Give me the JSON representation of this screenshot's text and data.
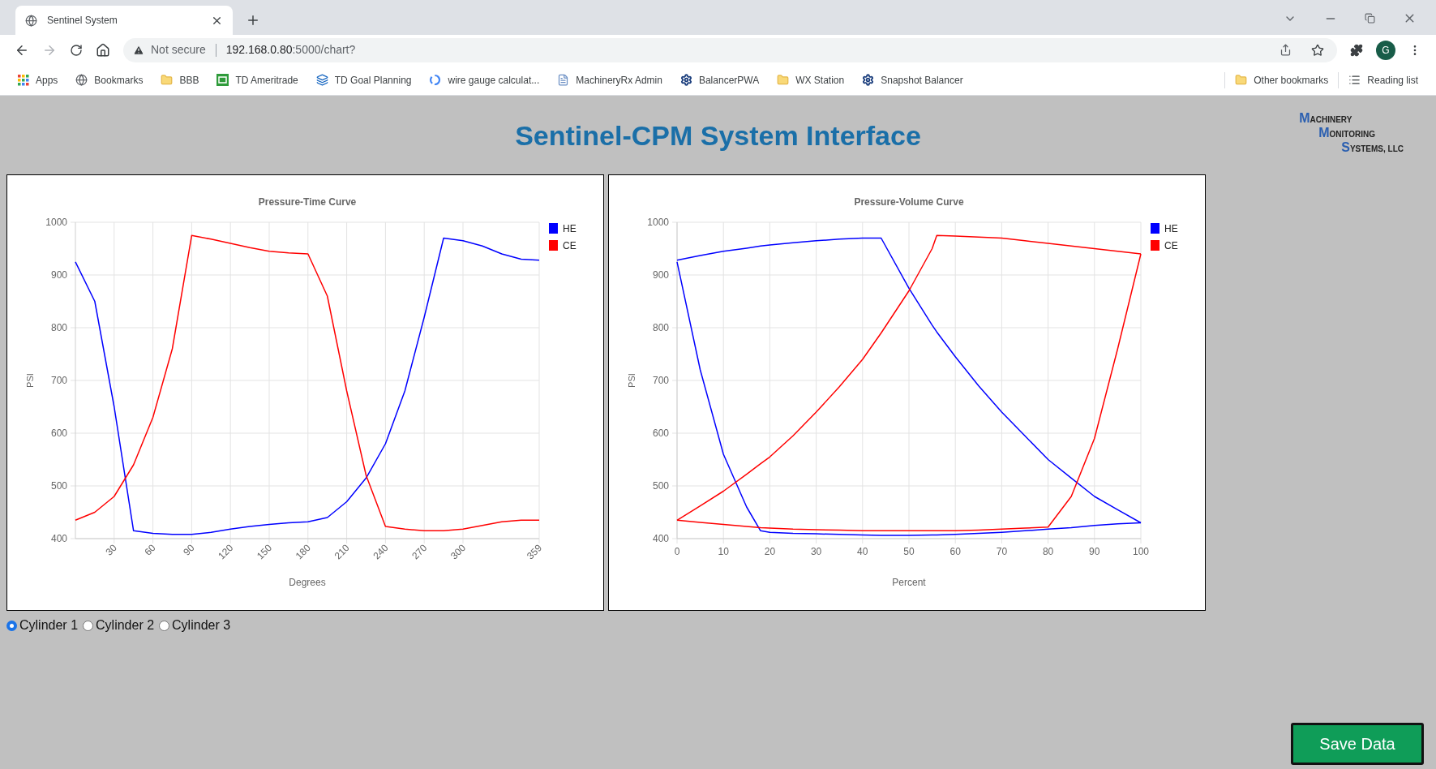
{
  "browser": {
    "tab": {
      "title": "Sentinel System"
    },
    "address": {
      "security": "Not secure",
      "host": "192.168.0.80",
      "path": ":5000/chart?"
    },
    "avatar": "G",
    "bookmarks": [
      {
        "kind": "apps",
        "label": "Apps"
      },
      {
        "kind": "globe",
        "label": "Bookmarks"
      },
      {
        "kind": "folder",
        "label": "BBB"
      },
      {
        "kind": "td",
        "label": "TD Ameritrade"
      },
      {
        "kind": "stack",
        "label": "TD Goal Planning"
      },
      {
        "kind": "google",
        "label": "wire gauge calculat..."
      },
      {
        "kind": "doc",
        "label": "MachineryRx Admin"
      },
      {
        "kind": "gear",
        "label": "BalancerPWA"
      },
      {
        "kind": "folder",
        "label": "WX Station"
      },
      {
        "kind": "gear",
        "label": "Snapshot Balancer"
      }
    ],
    "other_bookmarks": "Other bookmarks",
    "reading_list": "Reading list"
  },
  "page": {
    "title": "Sentinel-CPM System Interface",
    "logo": [
      "MACHINERY",
      "MONITORING",
      "SYSTEMS, LLC"
    ],
    "charts": [
      {
        "chart_data": {
          "type": "line",
          "title": "Pressure-Time Curve",
          "grid": true,
          "legend": true,
          "xlabel": "Degrees",
          "ylabel": "PSI",
          "xlim": [
            0,
            359
          ],
          "ylim": [
            400,
            1000
          ],
          "xticks": [
            30,
            60,
            90,
            120,
            150,
            180,
            210,
            240,
            270,
            300,
            359
          ],
          "yticks": [
            400,
            500,
            600,
            700,
            800,
            900,
            1000
          ],
          "x": [
            0,
            15,
            30,
            45,
            60,
            75,
            90,
            105,
            120,
            135,
            150,
            165,
            180,
            195,
            210,
            225,
            240,
            255,
            270,
            285,
            300,
            315,
            330,
            345,
            359
          ],
          "series": [
            {
              "name": "HE",
              "color": "#0000ff",
              "values": [
                925,
                850,
                650,
                415,
                410,
                408,
                408,
                412,
                418,
                423,
                427,
                430,
                432,
                440,
                470,
                515,
                580,
                680,
                820,
                970,
                965,
                955,
                940,
                930,
                928
              ]
            },
            {
              "name": "CE",
              "color": "#ff0000",
              "values": [
                435,
                450,
                480,
                540,
                630,
                760,
                975,
                968,
                960,
                952,
                945,
                942,
                940,
                860,
                680,
                520,
                423,
                418,
                415,
                415,
                418,
                425,
                432,
                435,
                435
              ]
            }
          ]
        }
      },
      {
        "chart_data": {
          "type": "line",
          "title": "Pressure-Volume Curve",
          "grid": true,
          "legend": true,
          "xlabel": "Percent",
          "ylabel": "PSI",
          "xlim": [
            0,
            100
          ],
          "ylim": [
            400,
            1000
          ],
          "xticks": [
            0,
            10,
            20,
            30,
            40,
            50,
            60,
            70,
            80,
            90,
            100
          ],
          "yticks": [
            400,
            500,
            600,
            700,
            800,
            900,
            1000
          ],
          "x": [
            0,
            5,
            10,
            15,
            18,
            20,
            25,
            30,
            35,
            40,
            44,
            50,
            55,
            56,
            60,
            65,
            70,
            75,
            80,
            85,
            90,
            95,
            100
          ],
          "series": [
            {
              "name": "HE",
              "color": "#0000ff",
              "values": [
                928,
                937,
                945,
                951,
                955,
                957,
                961,
                965,
                968,
                970,
                970,
                875,
                805,
                792,
                745,
                690,
                640,
                595,
                550,
                515,
                480,
                455,
                430
              ]
            },
            {
              "name": "HE",
              "color": "#0000ff",
              "values": [
                925,
                720,
                560,
                460,
                415,
                412,
                410,
                409,
                408,
                407,
                406,
                406,
                407,
                407,
                408,
                410,
                412,
                415,
                418,
                421,
                425,
                428,
                430
              ]
            },
            {
              "name": "CE",
              "color": "#ff0000",
              "values": [
                435,
                462,
                490,
                522,
                542,
                555,
                595,
                640,
                688,
                740,
                790,
                870,
                950,
                975,
                974,
                972,
                970,
                965,
                960,
                955,
                950,
                945,
                940
              ]
            },
            {
              "name": "CE",
              "color": "#ff0000",
              "values": [
                435,
                431,
                427,
                423,
                421,
                420,
                418,
                417,
                416,
                415,
                415,
                415,
                415,
                415,
                415,
                416,
                418,
                420,
                422,
                480,
                590,
                760,
                940
              ]
            }
          ]
        }
      }
    ],
    "cylinders": [
      {
        "label": "Cylinder 1",
        "selected": true
      },
      {
        "label": "Cylinder 2",
        "selected": false
      },
      {
        "label": "Cylinder 3",
        "selected": false
      }
    ],
    "save_button": "Save Data"
  }
}
